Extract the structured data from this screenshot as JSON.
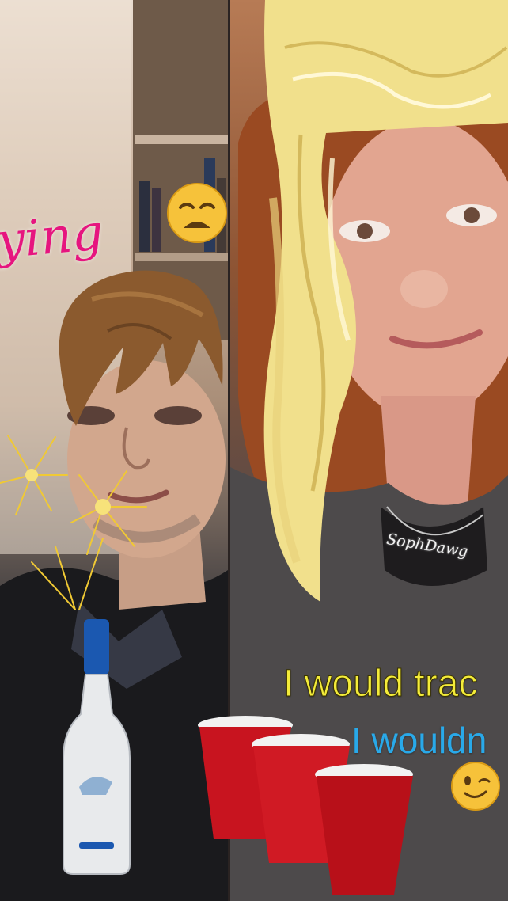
{
  "stickers": {
    "crying_text": "ying",
    "caption_line1": "I would trac",
    "caption_line2": "I wouldn",
    "necklace_text": "SophDawg"
  },
  "icons": {
    "emoji_weary": "weary-face-emoji-icon",
    "emoji_wink": "winking-face-emoji-icon",
    "vodka_bottle": "vodka-bottle-icon",
    "red_cups": "red-cups-icon",
    "fireworks": "fireworks-icon",
    "brown_wig": "brown-hair-wig-icon",
    "blonde_wig": "blonde-hair-wig-icon"
  },
  "colors": {
    "caption_yellow": "#f4ec3a",
    "caption_blue": "#29a9e9",
    "crying_pink": "#e6157f",
    "cup_red": "#c8141f"
  }
}
